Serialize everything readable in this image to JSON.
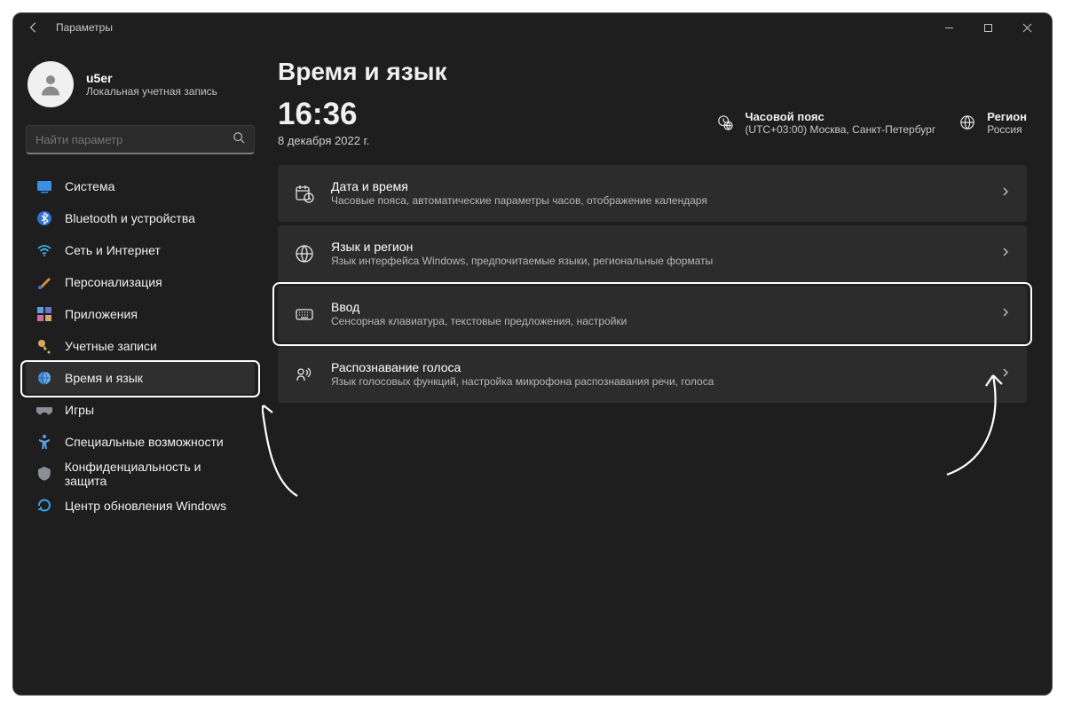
{
  "titlebar": {
    "title": "Параметры"
  },
  "profile": {
    "name": "u5er",
    "type": "Локальная учетная запись"
  },
  "search": {
    "placeholder": "Найти параметр"
  },
  "nav": {
    "items": [
      {
        "label": "Система"
      },
      {
        "label": "Bluetooth и устройства"
      },
      {
        "label": "Сеть и Интернет"
      },
      {
        "label": "Персонализация"
      },
      {
        "label": "Приложения"
      },
      {
        "label": "Учетные записи"
      },
      {
        "label": "Время и язык"
      },
      {
        "label": "Игры"
      },
      {
        "label": "Специальные возможности"
      },
      {
        "label": "Конфиденциальность и защита"
      },
      {
        "label": "Центр обновления Windows"
      }
    ],
    "active_index": 6
  },
  "page": {
    "title": "Время и язык",
    "clock": "16:36",
    "date": "8 декабря 2022 г.",
    "timezone": {
      "label": "Часовой пояс",
      "value": "(UTC+03:00) Москва, Санкт-Петербург"
    },
    "region": {
      "label": "Регион",
      "value": "Россия"
    }
  },
  "cards": [
    {
      "title": "Дата и время",
      "sub": "Часовые пояса, автоматические параметры часов, отображение календаря"
    },
    {
      "title": "Язык и регион",
      "sub": "Язык интерфейса Windows, предпочитаемые языки, региональные форматы"
    },
    {
      "title": "Ввод",
      "sub": "Сенсорная клавиатура, текстовые предложения, настройки"
    },
    {
      "title": "Распознавание голоса",
      "sub": "Язык голосовых функций, настройка микрофона распознавания речи, голоса"
    }
  ],
  "highlight_card_index": 2
}
